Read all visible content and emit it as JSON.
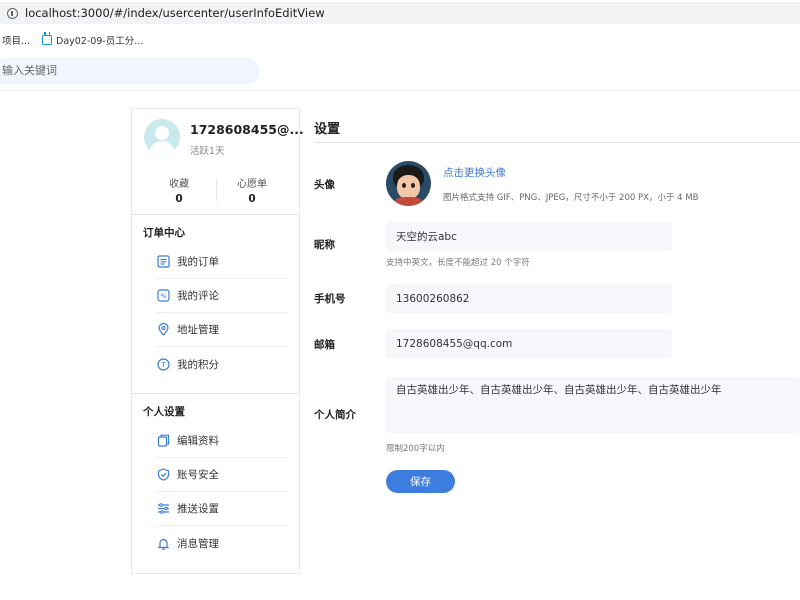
{
  "browser": {
    "url": "localhost:3000/#/index/usercenter/userInfoEditView",
    "bookmarks": [
      "项目...",
      "Day02-09-员工分..."
    ]
  },
  "search": {
    "placeholder": "输入关键词"
  },
  "sidebar": {
    "user": {
      "name": "1728608455@...",
      "active": "活跃1天"
    },
    "stats": [
      {
        "label": "收藏",
        "value": "0"
      },
      {
        "label": "心愿单",
        "value": "0"
      }
    ],
    "order_center": {
      "title": "订单中心",
      "items": [
        {
          "label": "我的订单",
          "icon": "order-list-icon"
        },
        {
          "label": "我的评论",
          "icon": "comment-icon"
        },
        {
          "label": "地址管理",
          "icon": "location-icon"
        },
        {
          "label": "我的积分",
          "icon": "points-icon"
        }
      ]
    },
    "personal": {
      "title": "个人设置",
      "items": [
        {
          "label": "编辑资料",
          "icon": "edit-profile-icon"
        },
        {
          "label": "账号安全",
          "icon": "shield-icon"
        },
        {
          "label": "推送设置",
          "icon": "sliders-icon"
        },
        {
          "label": "消息管理",
          "icon": "bell-icon"
        }
      ]
    }
  },
  "settings": {
    "title": "设置",
    "avatar": {
      "label": "头像",
      "change_link": "点击更换头像",
      "hint": "图片格式支持 GIF、PNG、JPEG，尺寸不小于 200 PX，小于 4 MB"
    },
    "nickname": {
      "label": "昵称",
      "value": "天空的云abc",
      "hint": "支持中英文，长度不能超过 20 个字符"
    },
    "phone": {
      "label": "手机号",
      "value": "13600260862"
    },
    "email": {
      "label": "邮箱",
      "value": "1728608455@qq.com"
    },
    "bio": {
      "label": "个人简介",
      "value": "自古英雄出少年、自古英雄出少年、自古英雄出少年、自古英雄出少年",
      "hint": "限制200字以内"
    },
    "save_label": "保存"
  },
  "colors": {
    "accent": "#3d7de0",
    "link": "#3a7bd5",
    "input_bg": "#f5f7fa"
  }
}
